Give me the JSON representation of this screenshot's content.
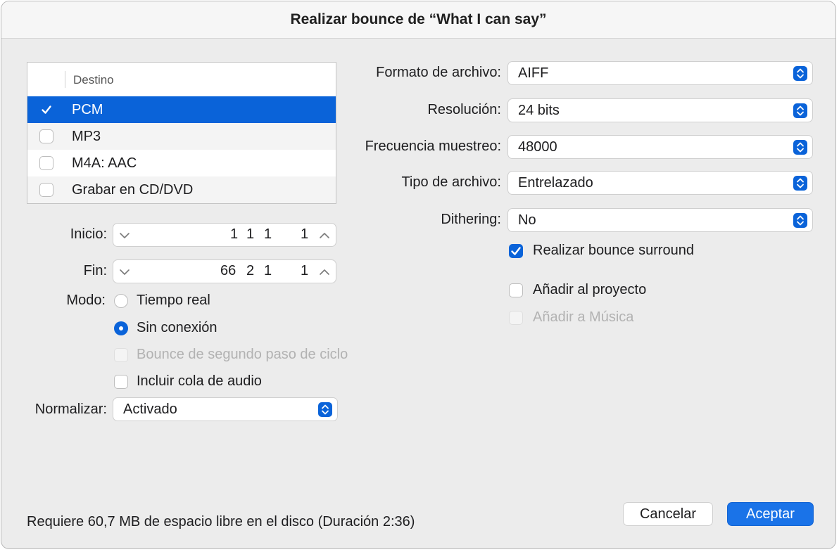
{
  "window": {
    "title": "Realizar bounce de “What I can say”"
  },
  "destination": {
    "header": "Destino",
    "items": [
      {
        "label": "PCM",
        "checked": true,
        "selected": true
      },
      {
        "label": "MP3",
        "checked": false,
        "selected": false
      },
      {
        "label": "M4A: AAC",
        "checked": false,
        "selected": false
      },
      {
        "label": "Grabar en CD/DVD",
        "checked": false,
        "selected": false
      }
    ]
  },
  "start": {
    "label": "Inicio:",
    "seg1": "1",
    "seg2": "1",
    "seg3": "1",
    "seg4": "1"
  },
  "end": {
    "label": "Fin:",
    "seg1": "66",
    "seg2": "2",
    "seg3": "1",
    "seg4": "1"
  },
  "mode": {
    "label": "Modo:",
    "realtime_label": "Tiempo real",
    "offline_label": "Sin conexión",
    "selected": "offline"
  },
  "options": {
    "cycle_second_pass": {
      "label": "Bounce de segundo paso de ciclo",
      "checked": false,
      "enabled": false
    },
    "include_tail": {
      "label": "Incluir cola de audio",
      "checked": false,
      "enabled": true
    }
  },
  "normalize": {
    "label": "Normalizar:",
    "value": "Activado"
  },
  "format": {
    "file_format": {
      "label": "Formato de archivo:",
      "value": "AIFF"
    },
    "resolution": {
      "label": "Resolución:",
      "value": "24 bits"
    },
    "sample_rate": {
      "label": "Frecuencia muestreo:",
      "value": "48000"
    },
    "file_type": {
      "label": "Tipo de archivo:",
      "value": "Entrelazado"
    },
    "dithering": {
      "label": "Dithering:",
      "value": "No"
    }
  },
  "right_options": {
    "surround": {
      "label": "Realizar bounce surround",
      "checked": true,
      "enabled": true
    },
    "add_project": {
      "label": "Añadir al proyecto",
      "checked": false,
      "enabled": true
    },
    "add_music": {
      "label": "Añadir a Música",
      "checked": false,
      "enabled": false
    }
  },
  "footer": {
    "requires": "Requiere 60,7 MB de espacio libre en el disco (Duración 2:36)",
    "cancel": "Cancelar",
    "ok": "Aceptar"
  },
  "colors": {
    "accent": "#0a63d9",
    "background": "#ececec"
  }
}
